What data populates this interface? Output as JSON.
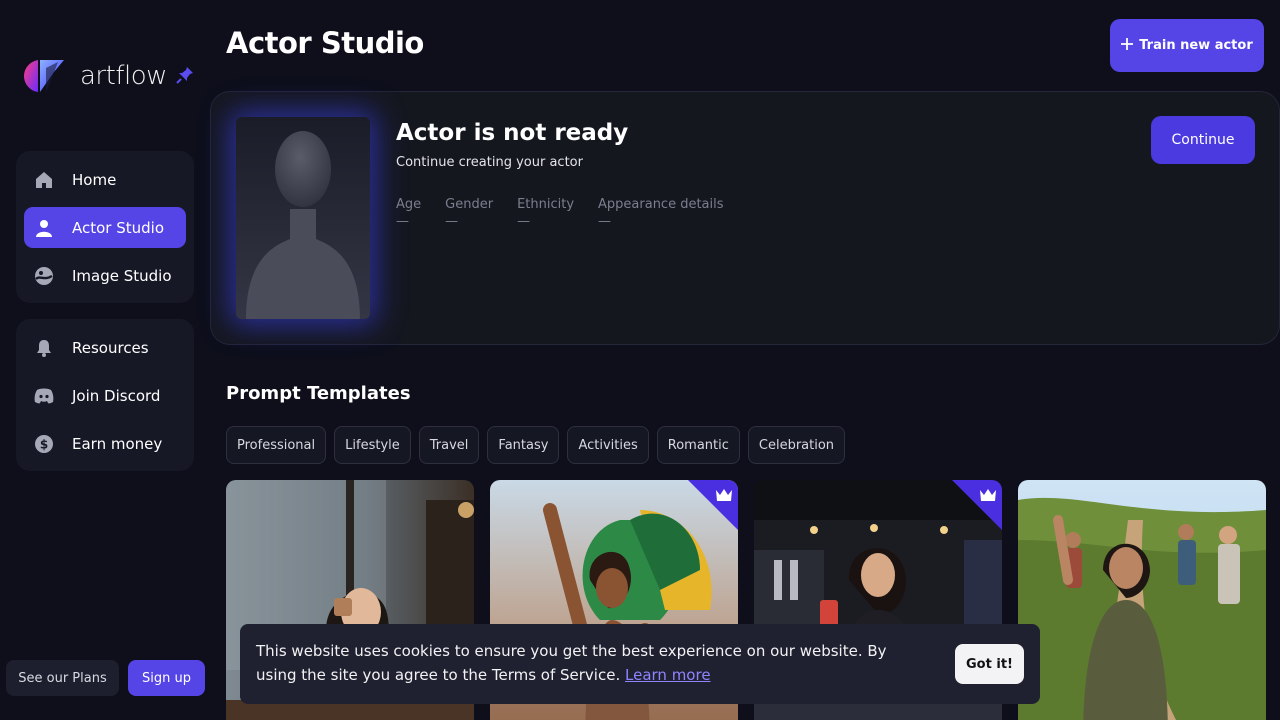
{
  "brand": {
    "name": "artflow"
  },
  "header": {
    "title": "Actor Studio",
    "train_label": "Train new actor"
  },
  "sidebar": {
    "primary": [
      {
        "label": "Home",
        "icon": "home-icon",
        "active": false
      },
      {
        "label": "Actor Studio",
        "icon": "person-icon",
        "active": true
      },
      {
        "label": "Image Studio",
        "icon": "image-studio-icon",
        "active": false
      }
    ],
    "secondary": [
      {
        "label": "Resources",
        "icon": "bell-icon"
      },
      {
        "label": "Join Discord",
        "icon": "discord-icon"
      },
      {
        "label": "Earn money",
        "icon": "dollar-icon"
      }
    ],
    "plans_label": "See our Plans",
    "signup_label": "Sign up"
  },
  "actor": {
    "title": "Actor is not ready",
    "subtitle": "Continue creating your actor",
    "continue_label": "Continue",
    "attributes": [
      {
        "label": "Age",
        "value": "—"
      },
      {
        "label": "Gender",
        "value": "—"
      },
      {
        "label": "Ethnicity",
        "value": "—"
      },
      {
        "label": "Appearance details",
        "value": "—"
      }
    ]
  },
  "templates": {
    "title": "Prompt Templates",
    "categories": [
      "Professional",
      "Lifestyle",
      "Travel",
      "Fantasy",
      "Activities",
      "Romantic",
      "Celebration"
    ],
    "cards": [
      {
        "name": "cafe-rain-template",
        "premium": false
      },
      {
        "name": "carnival-dancer-template",
        "premium": true
      },
      {
        "name": "bar-bartender-template",
        "premium": true
      },
      {
        "name": "hiking-group-template",
        "premium": false
      }
    ]
  },
  "cookie": {
    "message": "This website uses cookies to ensure you get the best experience on our website. By using the site you agree to the Terms of Service.",
    "link_label": "Learn more",
    "accept_label": "Got it!"
  },
  "colors": {
    "accent": "#5544e6",
    "background": "#0e0f1b",
    "panel": "#161826"
  }
}
